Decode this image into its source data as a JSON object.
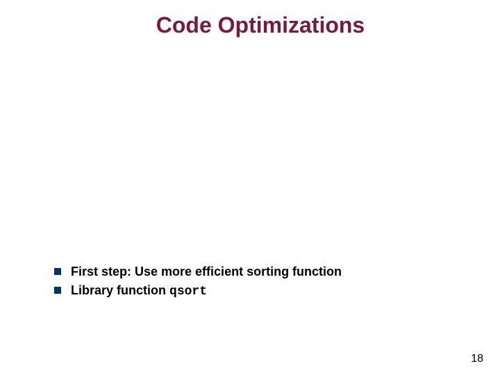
{
  "slide": {
    "title": "Code Optimizations",
    "bullets": [
      {
        "text": "First step: Use more efficient sorting function"
      },
      {
        "text_prefix": "Library function ",
        "code": "qsort"
      }
    ],
    "page_number": "18"
  }
}
